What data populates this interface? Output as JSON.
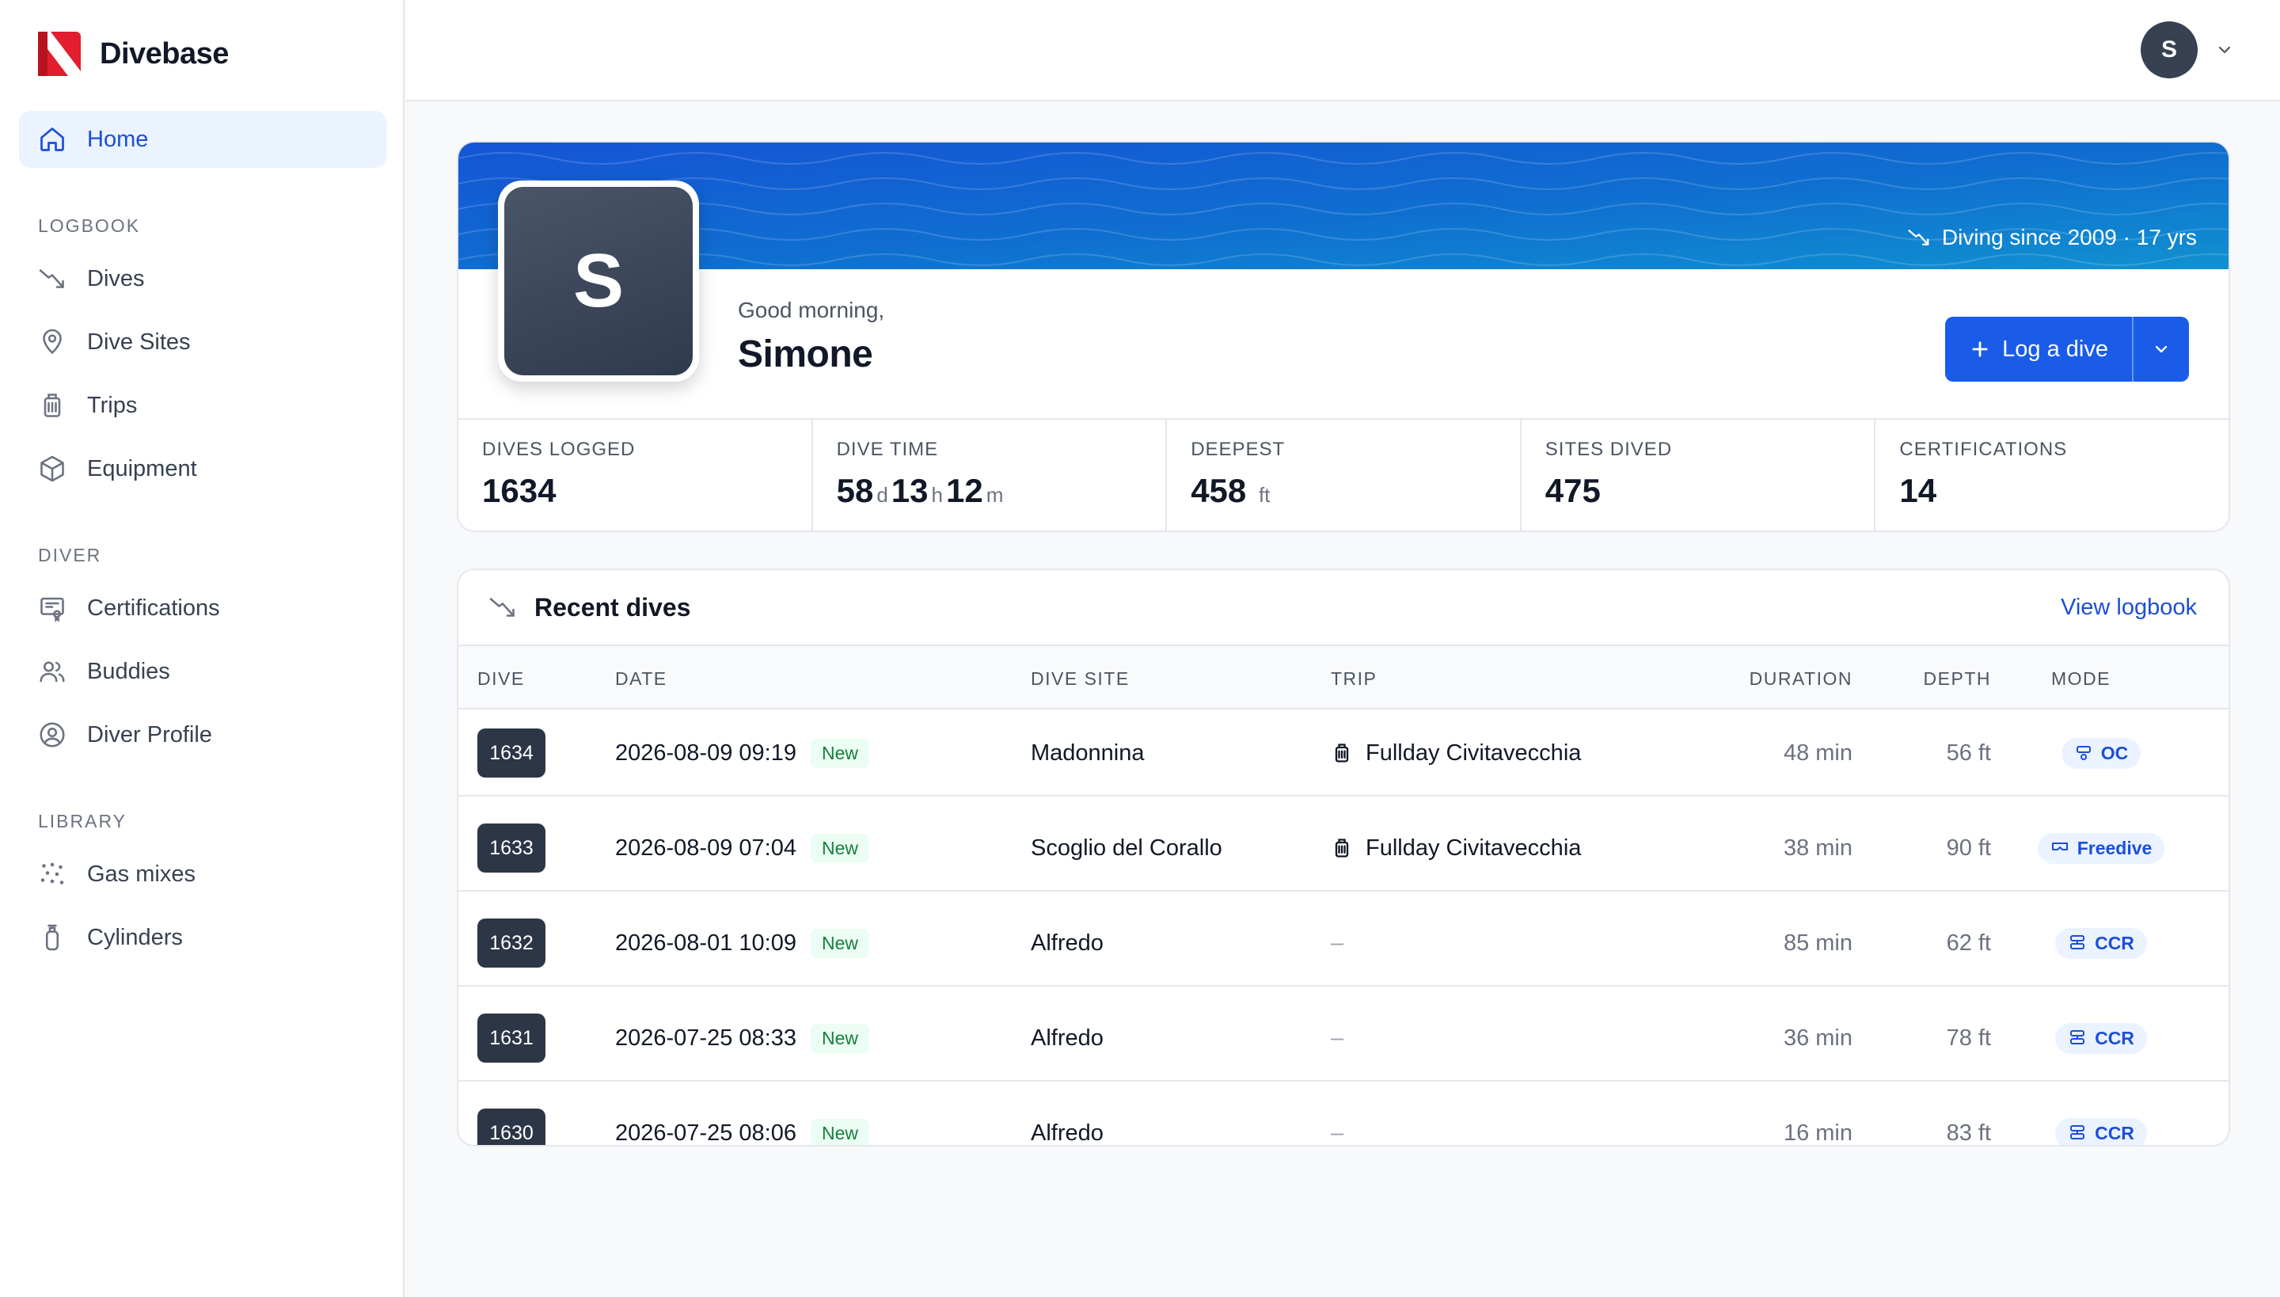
{
  "app": {
    "name": "Divebase"
  },
  "sidebar": {
    "home": "Home",
    "sections": [
      {
        "title": "LOGBOOK",
        "items": [
          "Dives",
          "Dive Sites",
          "Trips",
          "Equipment"
        ]
      },
      {
        "title": "DIVER",
        "items": [
          "Certifications",
          "Buddies",
          "Diver Profile"
        ]
      },
      {
        "title": "LIBRARY",
        "items": [
          "Gas mixes",
          "Cylinders"
        ]
      }
    ]
  },
  "header": {
    "avatar_initial": "S"
  },
  "profile": {
    "avatar_initial": "S",
    "since": "Diving since 2009 · 17 yrs",
    "greeting": "Good morning,",
    "name": "Simone",
    "log_button": "Log a dive",
    "stats": [
      {
        "label": "DIVES LOGGED",
        "value": "1634"
      },
      {
        "label": "DIVE TIME",
        "days": "58",
        "days_unit": "d",
        "hours": "13",
        "hours_unit": "h",
        "minutes": "12",
        "minutes_unit": "m"
      },
      {
        "label": "DEEPEST",
        "value": "458",
        "unit": "ft"
      },
      {
        "label": "SITES DIVED",
        "value": "475"
      },
      {
        "label": "CERTIFICATIONS",
        "value": "14"
      }
    ]
  },
  "recent": {
    "title": "Recent dives",
    "view_link": "View logbook",
    "columns": [
      "DIVE",
      "DATE",
      "DIVE SITE",
      "TRIP",
      "DURATION",
      "DEPTH",
      "MODE"
    ],
    "rows": [
      {
        "num": "1634",
        "date": "2026-08-09 09:19",
        "badge": "New",
        "site": "Madonnina",
        "trip": "Fullday Civitavecchia",
        "duration": "48 min",
        "depth": "56 ft",
        "mode": "OC"
      },
      {
        "num": "1633",
        "date": "2026-08-09 07:04",
        "badge": "New",
        "site": "Scoglio del Corallo",
        "trip": "Fullday Civitavecchia",
        "duration": "38 min",
        "depth": "90 ft",
        "mode": "Freedive"
      },
      {
        "num": "1632",
        "date": "2026-08-01 10:09",
        "badge": "New",
        "site": "Alfredo",
        "trip": "–",
        "duration": "85 min",
        "depth": "62 ft",
        "mode": "CCR"
      },
      {
        "num": "1631",
        "date": "2026-07-25 08:33",
        "badge": "New",
        "site": "Alfredo",
        "trip": "–",
        "duration": "36 min",
        "depth": "78 ft",
        "mode": "CCR"
      },
      {
        "num": "1630",
        "date": "2026-07-25 08:06",
        "badge": "New",
        "site": "Alfredo",
        "trip": "–",
        "duration": "16 min",
        "depth": "83 ft",
        "mode": "CCR"
      }
    ]
  },
  "colors": {
    "accent": "#1a5ce8",
    "banner_dark": "#1554d6",
    "banner_light": "#1191d0"
  }
}
